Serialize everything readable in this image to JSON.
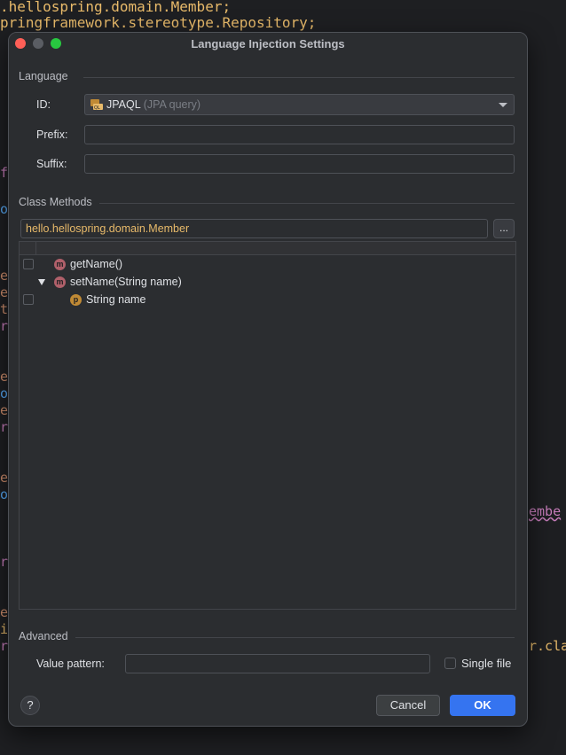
{
  "editor": {
    "line1": ".hellospring.domain.Member;",
    "line2": "pringframework.stereotype.Repository;",
    "fragments": [
      "f",
      "o",
      "e",
      "e",
      "t",
      "r",
      "e",
      "o",
      "e",
      "r",
      "e",
      "o",
      "embe",
      "r",
      "e",
      "i",
      "r",
      "r.cla"
    ]
  },
  "dialog": {
    "title": "Language Injection Settings",
    "language_section": "Language",
    "id_label": "ID:",
    "id_value": "JPAQL",
    "id_hint": "(JPA query)",
    "id_icon": "jpaql-icon",
    "prefix_label": "Prefix:",
    "prefix_value": "",
    "suffix_label": "Suffix:",
    "suffix_value": "",
    "class_methods_section": "Class Methods",
    "class_name": "hello.hellospring.domain.Member",
    "browse_label": "...",
    "tree": [
      {
        "label": "getName()",
        "badge": "m",
        "checked": false
      },
      {
        "label": "setName(String name)",
        "badge": "m",
        "expanded": true
      },
      {
        "label": "String name",
        "badge": "p",
        "checked": false
      }
    ],
    "advanced_section": "Advanced",
    "value_pattern_label": "Value pattern:",
    "value_pattern_value": "",
    "single_file_label": "Single file",
    "help_label": "?",
    "cancel_label": "Cancel",
    "ok_label": "OK"
  },
  "colors": {
    "accent": "#3574f0",
    "class_text": "#e8ba6a",
    "close": "#fe5f57",
    "maximize": "#28c840"
  }
}
